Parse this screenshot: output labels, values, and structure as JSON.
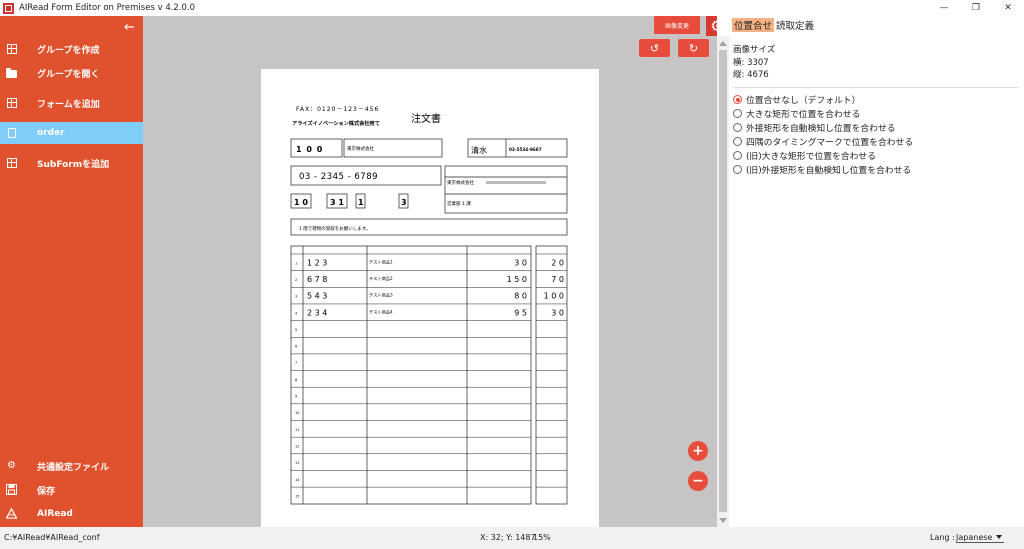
{
  "window": {
    "title": "AIRead Form Editor on Premises v 4.2.0.0"
  },
  "sidebar": {
    "items": [
      {
        "label": "グループを作成",
        "icon": "plus-box-icon"
      },
      {
        "label": "グループを開く",
        "icon": "folder-open-icon"
      },
      {
        "label": "フォームを追加",
        "icon": "plus-box-icon"
      },
      {
        "label": "order",
        "icon": "document-icon"
      },
      {
        "label": "SubFormを追加",
        "icon": "plus-box-icon"
      }
    ],
    "bottom": [
      {
        "label": "共通設定ファイル",
        "icon": "gear-icon"
      },
      {
        "label": "保存",
        "icon": "save-icon"
      },
      {
        "label": "AIRead",
        "icon": "airead-logo-icon"
      }
    ]
  },
  "toolbar": {
    "image_change_label": "画像変更"
  },
  "right_panel": {
    "tabs": [
      "位置合せ",
      "読取定義"
    ],
    "image_size_title": "画像サイズ",
    "image_width": "横: 3307",
    "image_height": "縦: 4676",
    "options": [
      "位置合せなし（デフォルト）",
      "大きな矩形で位置を合わせる",
      "外接矩形を自動検知し位置を合わせる",
      "四隅のタイミングマークで位置を合わせる",
      "(旧)大きな矩形で位置を合わせる",
      "(旧)外接矩形を自動検知し位置を合わせる"
    ],
    "selected_index": 0
  },
  "document": {
    "fax": "FAX：0120－123－456",
    "title": "注文書",
    "addressee": "アライズイノベーション株式会社宛て",
    "customer_code": "1 0 0",
    "company_name": "東京株式会社",
    "contact_name": "清水",
    "tel": "03-5534-9687",
    "phone": "03 - 2345 - 6789",
    "shipping_company": "東京株式会社",
    "department": "営業部 1 課",
    "date_month": "1 0",
    "date_day": "3 1",
    "box_a": "1",
    "box_b": "3",
    "remarks": "1 階で荷物の受取をお願いします。",
    "rows": [
      {
        "no": "1",
        "code": "1 2 3",
        "name": "テスト商品1",
        "qty": "3 0",
        "stock": "2 0"
      },
      {
        "no": "2",
        "code": "6 7 8",
        "name": "テスト商品2",
        "qty": "1 5 0",
        "stock": "7 0"
      },
      {
        "no": "3",
        "code": "5 4 3",
        "name": "テスト商品3",
        "qty": "8 0",
        "stock": "1 0 0"
      },
      {
        "no": "4",
        "code": "2 3 4",
        "name": "テスト商品4",
        "qty": "9 5",
        "stock": "3 0"
      },
      {
        "no": "5"
      },
      {
        "no": "6"
      },
      {
        "no": "7"
      },
      {
        "no": "8"
      },
      {
        "no": "9"
      },
      {
        "no": "10"
      },
      {
        "no": "11"
      },
      {
        "no": "12"
      },
      {
        "no": "13"
      },
      {
        "no": "14"
      },
      {
        "no": "15"
      }
    ]
  },
  "status": {
    "path": "C:¥AIRead¥AIRead_conf",
    "coord": "X: 32; Y: 1487",
    "zoom": "15%",
    "lang_label": "Lang :",
    "lang_value": "Japanese"
  }
}
